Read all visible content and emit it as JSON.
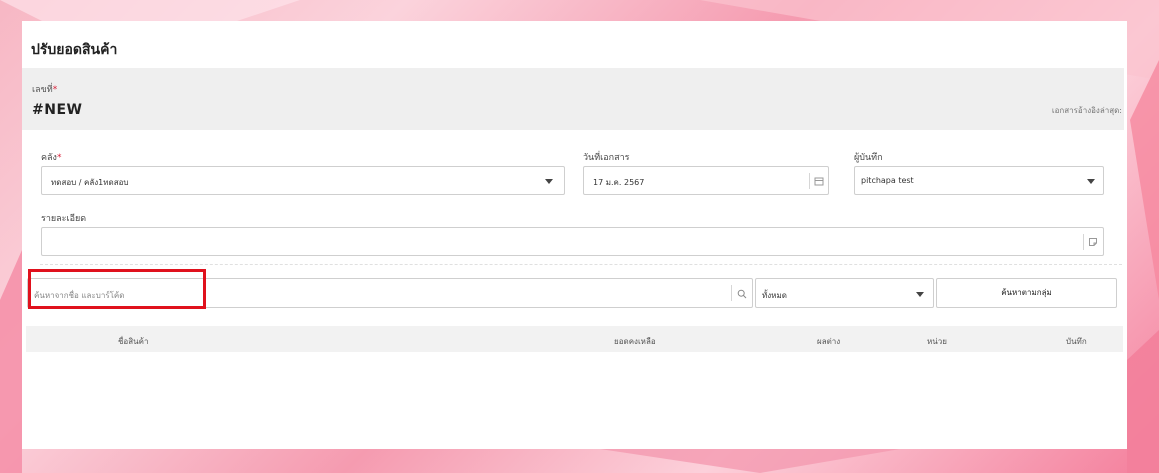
{
  "page": {
    "title": "ปรับยอดสินค้า"
  },
  "document": {
    "number_label": "เลขที่",
    "number_value": "#NEW",
    "last_used_label": "เอกสารอ้างอิงล่าสุด:"
  },
  "form": {
    "warehouse": {
      "label": "คลัง",
      "value": "ทดสอบ / คลัง1ทดสอบ"
    },
    "doc_date": {
      "label": "วันที่เอกสาร",
      "value": "17 ม.ค. 2567"
    },
    "recorder": {
      "label": "ผู้บันทึก",
      "value": "pitchapa test"
    },
    "details": {
      "label": "รายละเอียด",
      "value": ""
    }
  },
  "search": {
    "placeholder": "ค้นหาจากชื่อ และบาร์โค้ด",
    "filter_value": "ทั้งหมด",
    "group_search_label": "ค้นหาตามกลุ่ม"
  },
  "table": {
    "columns": [
      "ชื่อสินค้า",
      "ยอดคงเหลือ",
      "ผลต่าง",
      "หน่วย",
      "บันทึก"
    ]
  },
  "colors": {
    "highlight": "#e0111d",
    "required": "#d9213a",
    "accent_bg": "#f7b7c4"
  }
}
